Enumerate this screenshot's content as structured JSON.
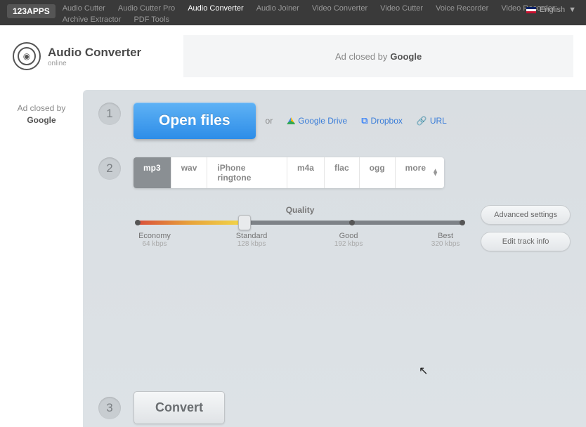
{
  "nav": {
    "logo": "123APPS",
    "items": [
      "Audio Cutter",
      "Audio Cutter Pro",
      "Audio Converter",
      "Audio Joiner",
      "Video Converter",
      "Video Cutter",
      "Voice Recorder",
      "Video Recorder",
      "Archive Extractor",
      "PDF Tools"
    ],
    "active_index": 2,
    "language": "English"
  },
  "app": {
    "title": "Audio Converter",
    "subtitle": "online"
  },
  "ads": {
    "top_prefix": "Ad closed by",
    "top_brand": "Google",
    "side_prefix": "Ad closed by",
    "side_brand": "Google"
  },
  "step1": {
    "num": "1",
    "open_label": "Open files",
    "or": "or",
    "google_drive": "Google Drive",
    "dropbox": "Dropbox",
    "url": "URL"
  },
  "step2": {
    "num": "2",
    "formats": [
      "mp3",
      "wav",
      "iPhone ringtone",
      "m4a",
      "flac",
      "ogg",
      "more"
    ],
    "active_format_index": 0,
    "quality_label": "Quality",
    "marks": [
      {
        "name": "Economy",
        "val": "64 kbps"
      },
      {
        "name": "Standard",
        "val": "128 kbps"
      },
      {
        "name": "Good",
        "val": "192 kbps"
      },
      {
        "name": "Best",
        "val": "320 kbps"
      }
    ],
    "advanced": "Advanced settings",
    "edit_info": "Edit track info"
  },
  "step3": {
    "num": "3",
    "convert": "Convert"
  }
}
